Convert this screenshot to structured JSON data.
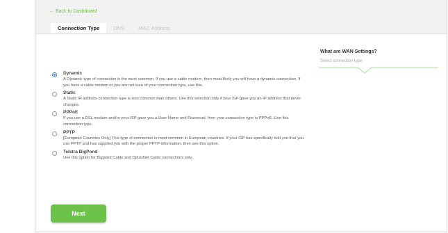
{
  "header": {
    "back_link": "← Back to Dashboard"
  },
  "tabs": [
    {
      "label": "Connection Type",
      "active": true
    },
    {
      "label": "DNS",
      "active": false
    },
    {
      "label": "MAC Address",
      "active": false
    }
  ],
  "side": {
    "title": "What are WAN Settings?",
    "subtitle": "Select connection type"
  },
  "options": [
    {
      "title": "Dynamic",
      "selected": true,
      "desc": "A Dynamic type of connection is the most common. If you use a cable modem, then most likely you will have a dynamic connection. If you have a cable modem or you are not sure of your connection type, use this."
    },
    {
      "title": "Static",
      "selected": false,
      "desc": "A Static IP address connection type is less common than others. Use this selection only if your ISP gave you an IP address that never changes."
    },
    {
      "title": "PPPoE",
      "selected": false,
      "desc": "If you use a DSL modem and/or your ISP gave you a User Name and Password, then your connection type is PPPoE. Use this connection type."
    },
    {
      "title": "PPTP",
      "selected": false,
      "desc": "[European Countries Only] This type of connection is most common in European countries. If your ISP has specifically told you that you use PPTP and has supplied you with the proper PPTP information, then use this option."
    },
    {
      "title": "Telstra BigPond",
      "selected": false,
      "desc": "Use this option for Bigpond Cable and OptusNet Cable connections only."
    }
  ],
  "next_button": "Next",
  "colors": {
    "accent_green": "#6cc24a",
    "radio_blue": "#4a8ed4"
  }
}
